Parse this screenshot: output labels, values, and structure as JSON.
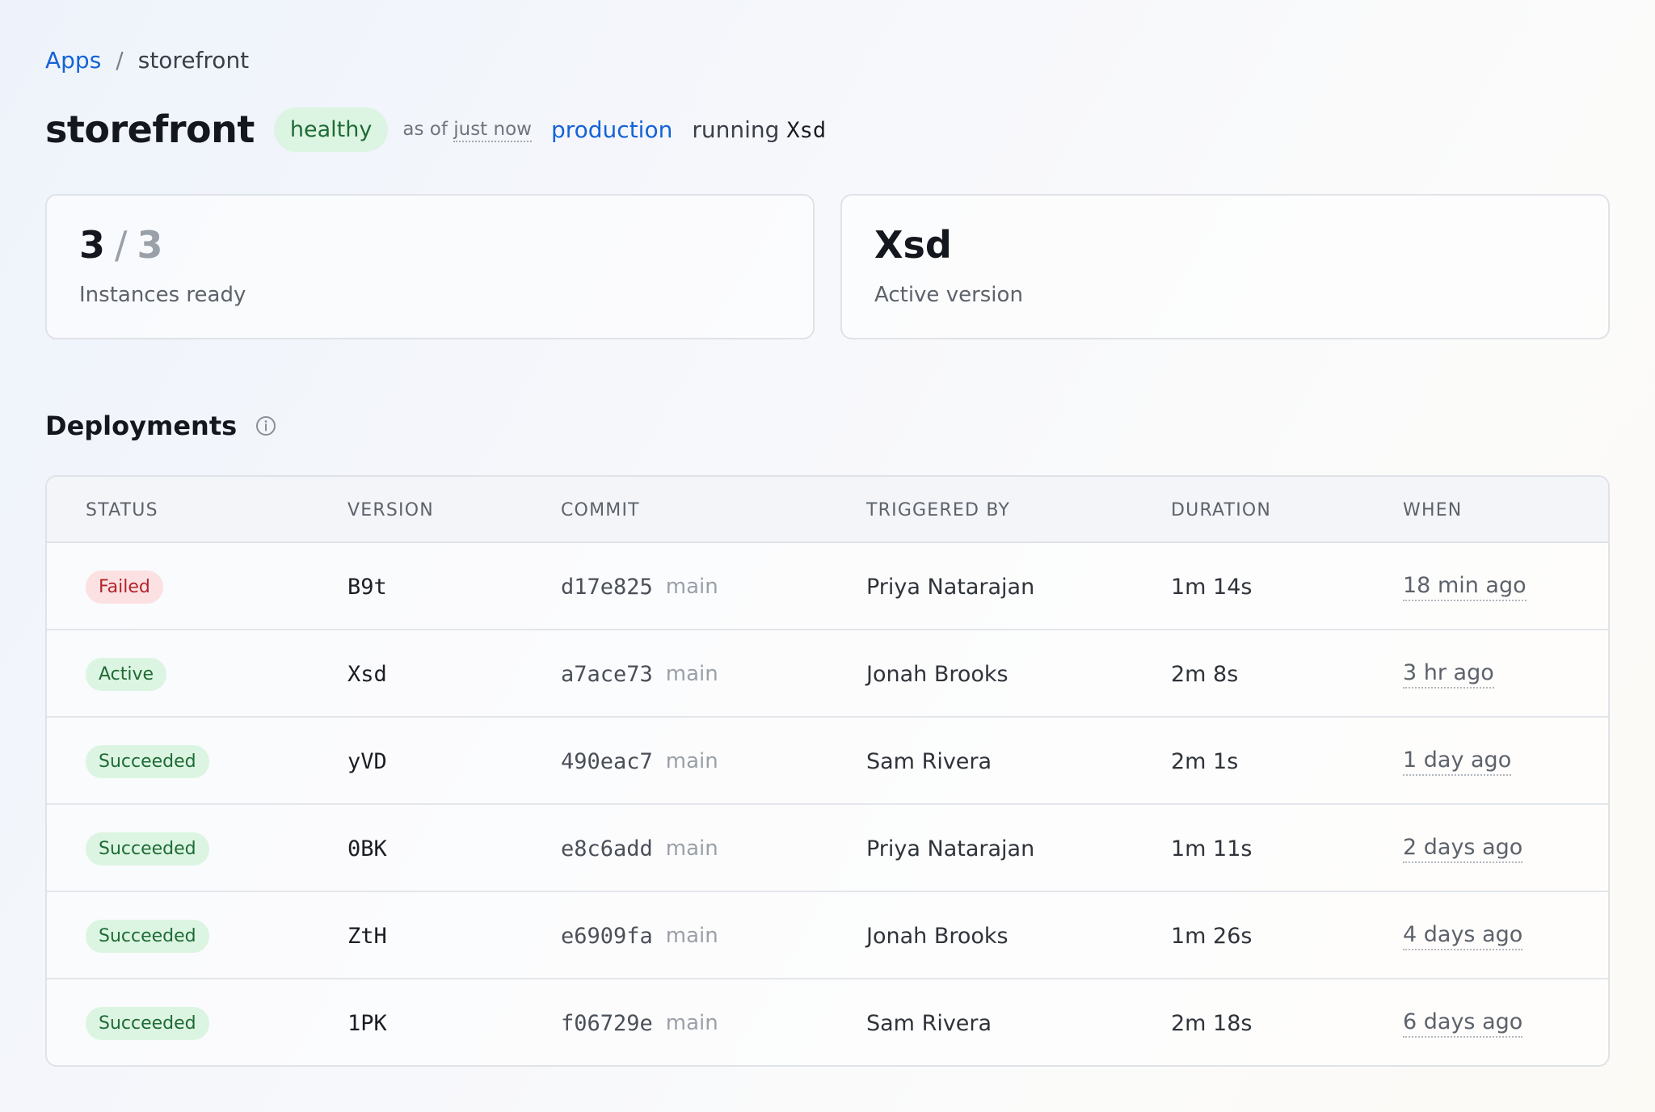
{
  "breadcrumb": {
    "root": "Apps",
    "separator": "/",
    "current": "storefront"
  },
  "header": {
    "title": "storefront",
    "health": "healthy",
    "as_of_prefix": "as of",
    "as_of_when": "just now",
    "environment": "production",
    "running_label": "running",
    "running_version": "Xsd"
  },
  "stats": {
    "instances": {
      "ready": "3",
      "separator": "/",
      "total": "3",
      "label": "Instances ready"
    },
    "version": {
      "value": "Xsd",
      "label": "Active version"
    }
  },
  "deployments": {
    "title": "Deployments",
    "info_icon": "info-icon",
    "columns": [
      "STATUS",
      "VERSION",
      "COMMIT",
      "TRIGGERED BY",
      "DURATION",
      "WHEN"
    ],
    "rows": [
      {
        "status": "Failed",
        "version": "B9t",
        "sha": "d17e825",
        "branch": "main",
        "triggered_by": "Priya Natarajan",
        "duration": "1m 14s",
        "when": "18 min ago"
      },
      {
        "status": "Active",
        "version": "Xsd",
        "sha": "a7ace73",
        "branch": "main",
        "triggered_by": "Jonah Brooks",
        "duration": "2m 8s",
        "when": "3 hr ago"
      },
      {
        "status": "Succeeded",
        "version": "yVD",
        "sha": "490eac7",
        "branch": "main",
        "triggered_by": "Sam Rivera",
        "duration": "2m 1s",
        "when": "1 day ago"
      },
      {
        "status": "Succeeded",
        "version": "0BK",
        "sha": "e8c6add",
        "branch": "main",
        "triggered_by": "Priya Natarajan",
        "duration": "1m 11s",
        "when": "2 days ago"
      },
      {
        "status": "Succeeded",
        "version": "ZtH",
        "sha": "e6909fa",
        "branch": "main",
        "triggered_by": "Jonah Brooks",
        "duration": "1m 26s",
        "when": "4 days ago"
      },
      {
        "status": "Succeeded",
        "version": "1PK",
        "sha": "f06729e",
        "branch": "main",
        "triggered_by": "Sam Rivera",
        "duration": "2m 18s",
        "when": "6 days ago"
      }
    ]
  },
  "colors": {
    "link": "#1463d6",
    "success_bg": "#dcf5e2",
    "success_fg": "#1f6b35",
    "failed_bg": "#fbe1e2",
    "failed_fg": "#b3232b"
  }
}
